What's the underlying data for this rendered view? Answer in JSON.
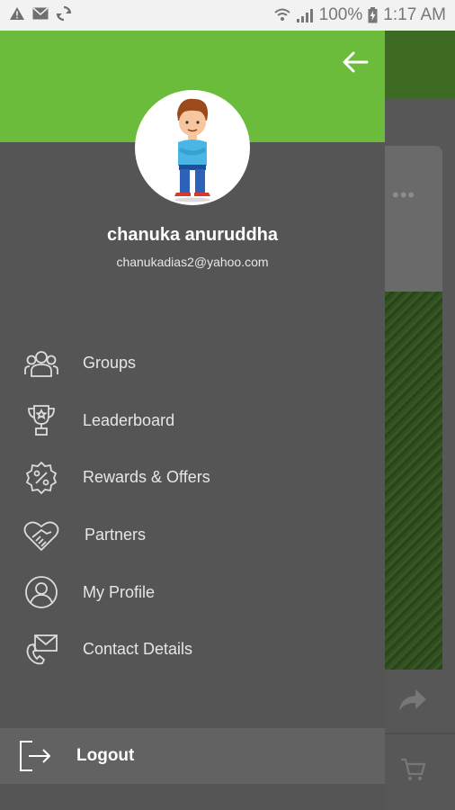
{
  "status_bar": {
    "battery": "100%",
    "time": "1:17 AM",
    "icons": [
      "warning-icon",
      "mail-icon",
      "sync-icon",
      "wifi-icon",
      "signal-icon",
      "battery-charging-icon"
    ]
  },
  "drawer": {
    "accent_color": "#6abc3a",
    "background_color": "#555555",
    "back_icon": "arrow-left-icon",
    "user": {
      "name": "chanuka anuruddha",
      "email": "chanukadias2@yahoo.com"
    },
    "menu": [
      {
        "label": "Groups",
        "icon": "groups-icon"
      },
      {
        "label": "Leaderboard",
        "icon": "trophy-icon"
      },
      {
        "label": "Rewards & Offers",
        "icon": "discount-badge-icon"
      },
      {
        "label": "Partners",
        "icon": "handshake-heart-icon"
      },
      {
        "label": "My Profile",
        "icon": "user-circle-icon"
      },
      {
        "label": "Contact Details",
        "icon": "contact-mail-icon"
      }
    ],
    "logout": {
      "label": "Logout",
      "icon": "logout-icon"
    }
  },
  "background": {
    "icons": [
      "more-dots-icon",
      "share-icon",
      "cart-icon"
    ],
    "more_dots": "•••"
  }
}
